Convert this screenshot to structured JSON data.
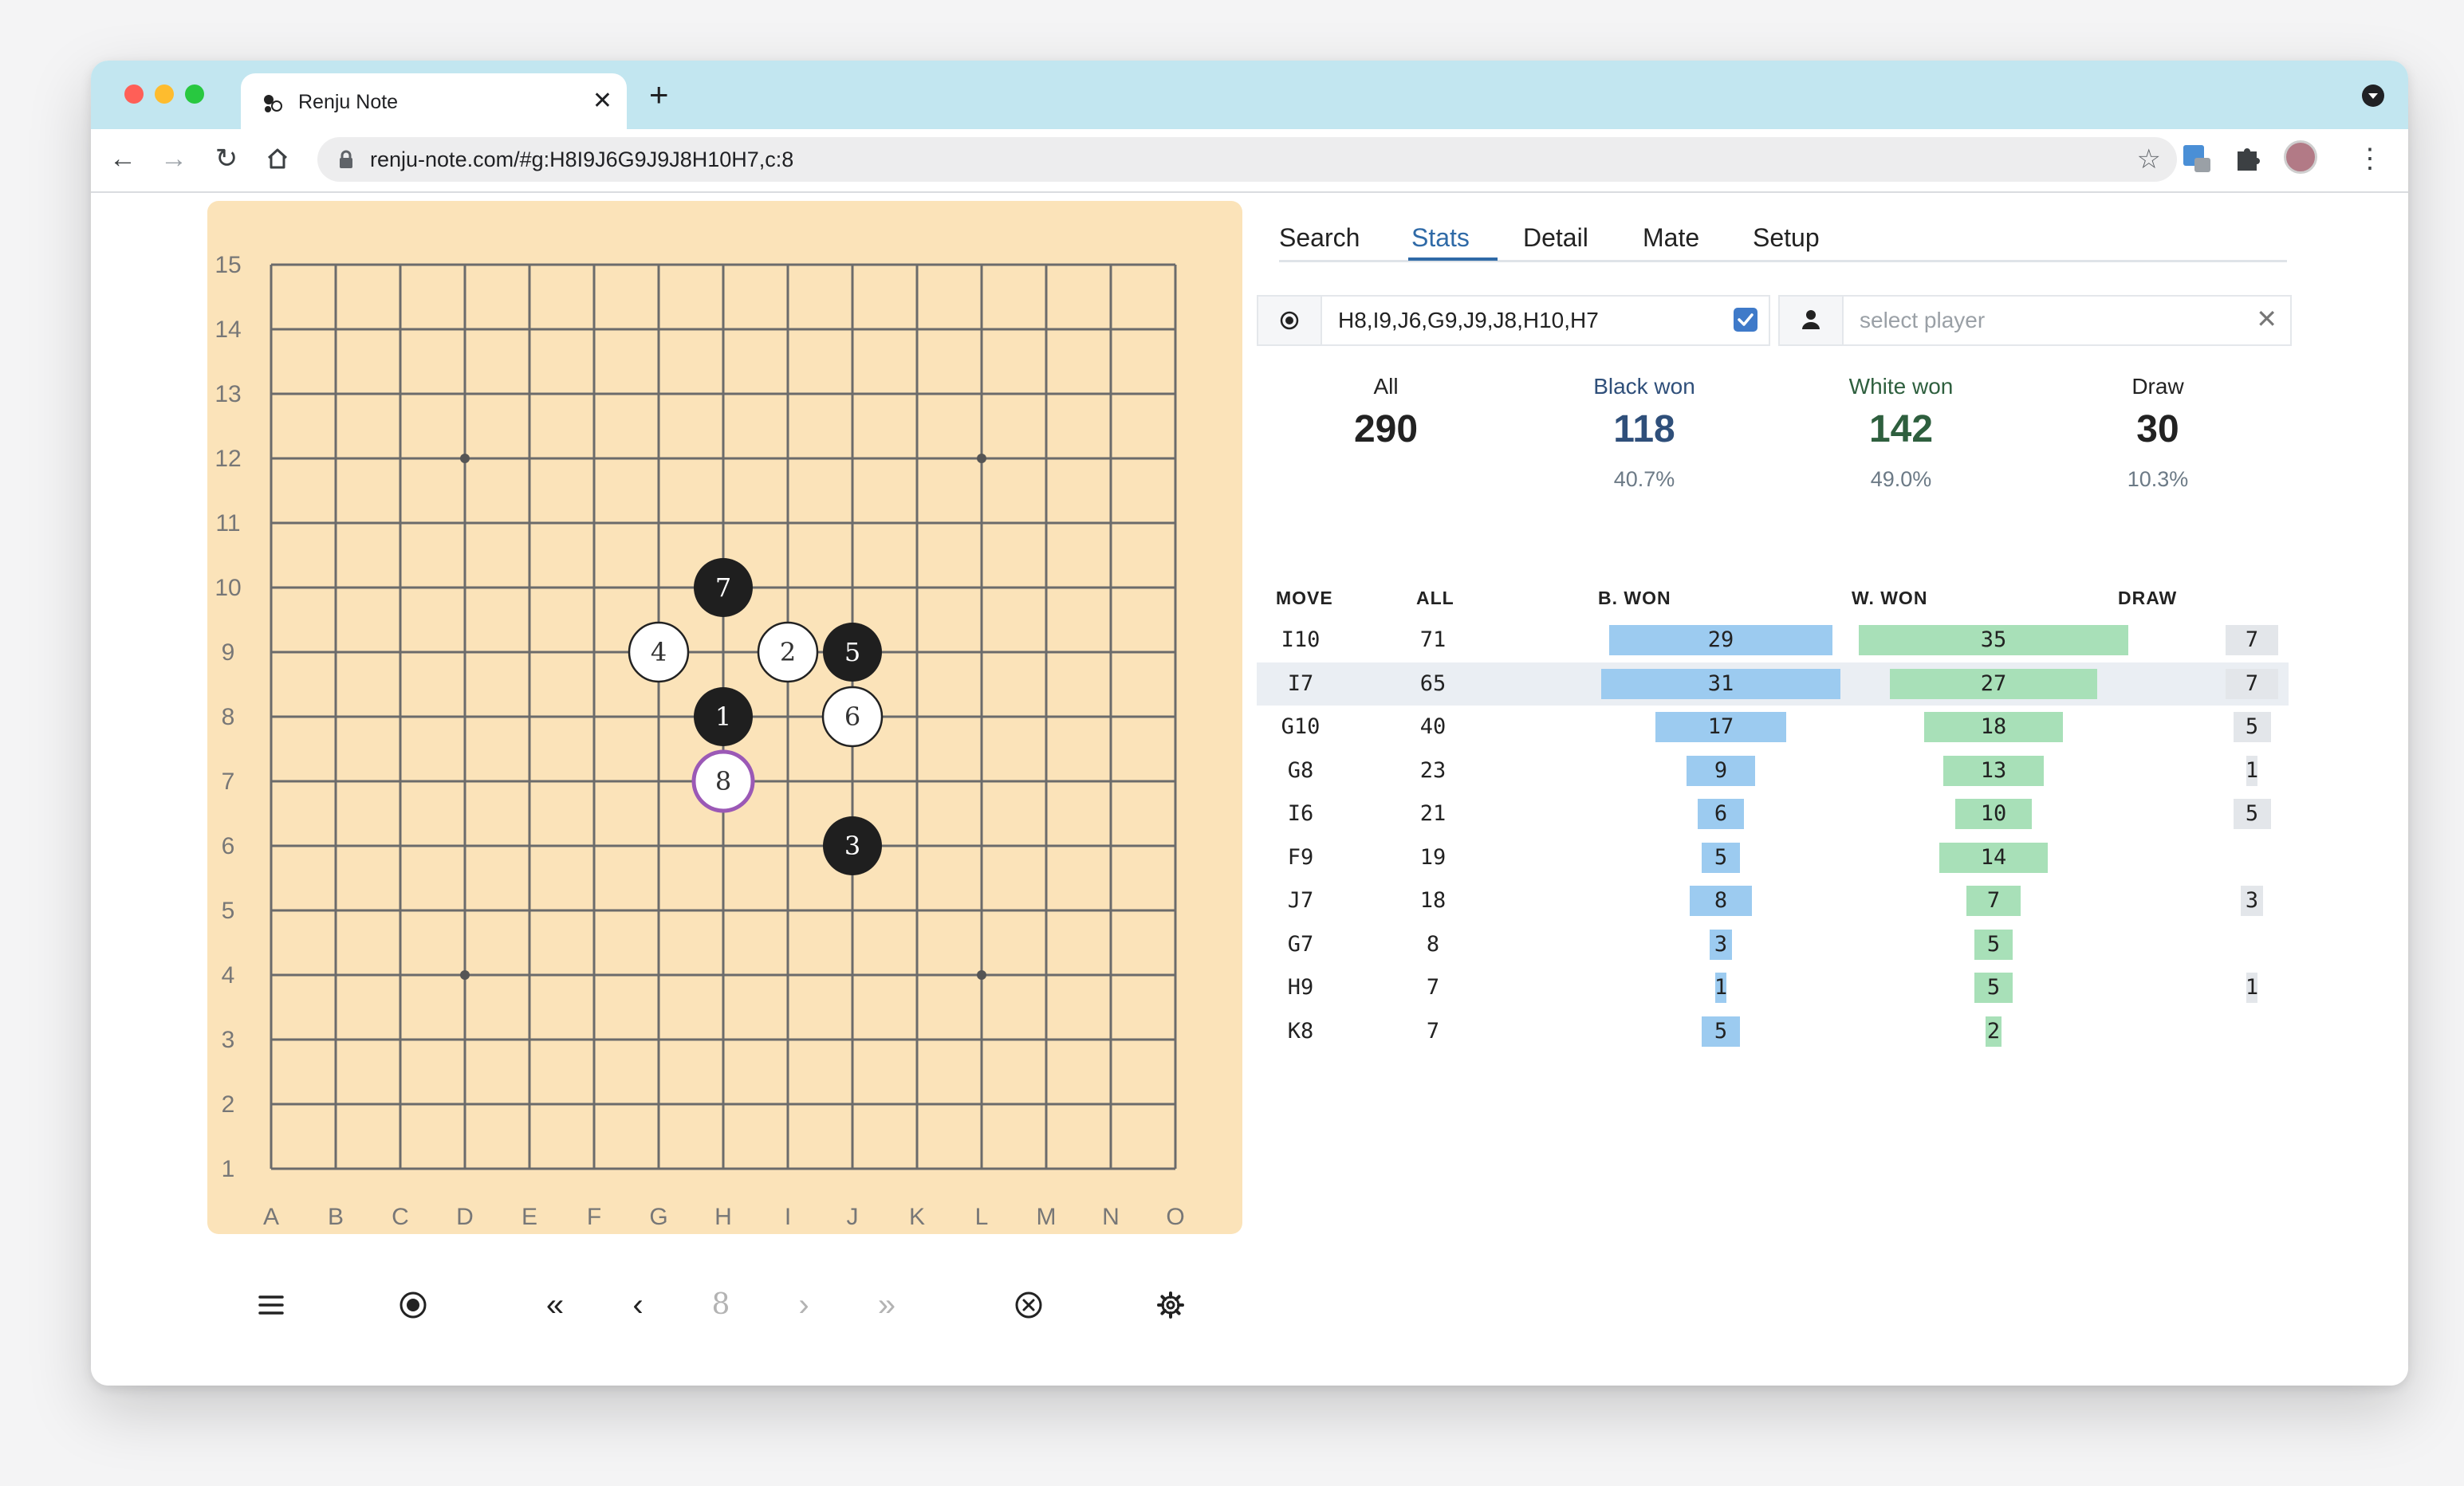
{
  "browser": {
    "tab_title": "Renju Note",
    "url": "renju-note.com/#g:H8I9J6G9J9J8H10H7,c:8",
    "traffic_colors": [
      "#ff5f57",
      "#febc2e",
      "#28c840"
    ]
  },
  "board": {
    "size": 15,
    "columns": [
      "A",
      "B",
      "C",
      "D",
      "E",
      "F",
      "G",
      "H",
      "I",
      "J",
      "K",
      "L",
      "M",
      "N",
      "O"
    ],
    "rows": [
      "15",
      "14",
      "13",
      "12",
      "11",
      "10",
      "9",
      "8",
      "7",
      "6",
      "5",
      "4",
      "3",
      "2",
      "1"
    ],
    "star_points": [
      "D12",
      "L12",
      "D4",
      "L4",
      "H8"
    ],
    "colors": {
      "background": "#fbe3b9",
      "grid": "#6b6b6b",
      "black_stone": "#1f1f1f",
      "white_stone": "#ffffff",
      "last_move_ring": "#9b59b6"
    },
    "stones": [
      {
        "n": "1",
        "col": "H",
        "row": 8,
        "color": "black"
      },
      {
        "n": "2",
        "col": "I",
        "row": 9,
        "color": "white"
      },
      {
        "n": "3",
        "col": "J",
        "row": 6,
        "color": "black"
      },
      {
        "n": "4",
        "col": "G",
        "row": 9,
        "color": "white"
      },
      {
        "n": "5",
        "col": "J",
        "row": 9,
        "color": "black"
      },
      {
        "n": "6",
        "col": "J",
        "row": 8,
        "color": "white"
      },
      {
        "n": "7",
        "col": "H",
        "row": 10,
        "color": "black"
      },
      {
        "n": "8",
        "col": "H",
        "row": 7,
        "color": "white",
        "last": true
      }
    ]
  },
  "controls": {
    "menu_icon": "menu-icon",
    "record_icon": "record-icon",
    "first_icon": "double-chevron-left-icon",
    "prev_icon": "chevron-left-icon",
    "move_number": "8",
    "next_icon": "chevron-right-icon",
    "last_icon": "double-chevron-right-icon",
    "clear_icon": "circle-x-icon",
    "settings_icon": "gear-icon"
  },
  "tabs": [
    {
      "label": "Search",
      "active": false
    },
    {
      "label": "Stats",
      "active": true
    },
    {
      "label": "Detail",
      "active": false
    },
    {
      "label": "Mate",
      "active": false
    },
    {
      "label": "Setup",
      "active": false
    }
  ],
  "filter": {
    "moves_value": "H8,I9,J6,G9,J9,J8,H10,H7",
    "moves_checked": true,
    "player_placeholder": "select player"
  },
  "summary": {
    "all_label": "All",
    "all_value": "290",
    "black_label": "Black won",
    "black_value": "118",
    "black_pct": "40.7%",
    "white_label": "White won",
    "white_value": "142",
    "white_pct": "49.0%",
    "draw_label": "Draw",
    "draw_value": "30",
    "draw_pct": "10.3%"
  },
  "table": {
    "headers": {
      "move": "MOVE",
      "all": "ALL",
      "bwon": "B. WON",
      "wwon": "W. WON",
      "draw": "DRAW"
    },
    "bar_colors": {
      "bwon": "#9ccbf0",
      "wwon": "#a8e0b8",
      "draw": "#e3e6ea"
    },
    "rows": [
      {
        "move": "I10",
        "all": "71",
        "bwon": "29",
        "wwon": "35",
        "draw": "7"
      },
      {
        "move": "I7",
        "all": "65",
        "bwon": "31",
        "wwon": "27",
        "draw": "7",
        "highlight": true
      },
      {
        "move": "G10",
        "all": "40",
        "bwon": "17",
        "wwon": "18",
        "draw": "5"
      },
      {
        "move": "G8",
        "all": "23",
        "bwon": "9",
        "wwon": "13",
        "draw": "1"
      },
      {
        "move": "I6",
        "all": "21",
        "bwon": "6",
        "wwon": "10",
        "draw": "5"
      },
      {
        "move": "F9",
        "all": "19",
        "bwon": "5",
        "wwon": "14",
        "draw": ""
      },
      {
        "move": "J7",
        "all": "18",
        "bwon": "8",
        "wwon": "7",
        "draw": "3"
      },
      {
        "move": "G7",
        "all": "8",
        "bwon": "3",
        "wwon": "5",
        "draw": ""
      },
      {
        "move": "H9",
        "all": "7",
        "bwon": "1",
        "wwon": "5",
        "draw": "1"
      },
      {
        "move": "K8",
        "all": "7",
        "bwon": "5",
        "wwon": "2",
        "draw": ""
      }
    ]
  }
}
